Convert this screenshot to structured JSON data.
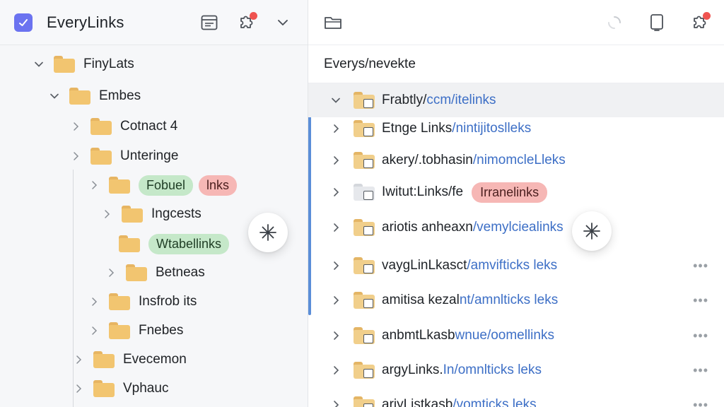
{
  "app": {
    "title": "EveryLinks"
  },
  "colors": {
    "accent": "#6b73f0",
    "link": "#3d6fc6",
    "folder": "#f2c570",
    "badge_red": "#ef5350",
    "pill_green": "#c5e8c9",
    "pill_red": "#f6b7b5"
  },
  "left_header": {
    "icons": [
      "browser-window-icon",
      "puzzle-icon",
      "chevron-down-icon"
    ]
  },
  "tree": [
    {
      "label": "FinyLats",
      "expanded": true,
      "level": 0
    },
    {
      "label": "Embes",
      "expanded": true,
      "level": 1
    },
    {
      "label": "Cotnact 4",
      "expanded": false,
      "level": 2
    },
    {
      "label": "Unteringe",
      "expanded": false,
      "level": 2
    },
    {
      "label": "Fobuel",
      "tag": "lnks",
      "level": 3
    },
    {
      "label": "Ingcests",
      "level": 4
    },
    {
      "label": "Wtabellinks",
      "level": 4
    },
    {
      "label": "Betneas",
      "level": 4
    },
    {
      "label": "Insfrob its",
      "level": 3
    },
    {
      "label": "Fnebes",
      "level": 3
    },
    {
      "label": "Evecemon",
      "level": 2
    },
    {
      "label": "Vphauc",
      "level": 2
    }
  ],
  "right_header": {
    "icons": [
      "folder-icon",
      "loading-spinner-icon",
      "tablet-icon",
      "puzzle-icon"
    ]
  },
  "path": "Everys/nevekte",
  "rows": [
    {
      "name": "Frabtly/",
      "link": "ccm/itelinks",
      "selected": true,
      "more": false
    },
    {
      "name": "Etnge Links",
      "link": "/nintijitoslleks",
      "more": false
    },
    {
      "name": "akery/.tobhasin",
      "link": "/nimomcleLleks",
      "more": false
    },
    {
      "name": "Iwitut:Links/fe",
      "tag": "Irranelinks",
      "more": false
    },
    {
      "name": "ariotis anheaxn",
      "link": "/vemylciealinks",
      "more": false
    },
    {
      "name": "vaygLinLkasct",
      "link": "/amvifticks leks",
      "more": true
    },
    {
      "name": "amitisa kezal",
      "link": "nt/amnlticks leks",
      "more": true
    },
    {
      "name": "anbmtLkasb",
      "link": "wnue/oomellinks",
      "more": true
    },
    {
      "name": "argyLinks.",
      "link": "In/omnlticks leks",
      "more": true
    },
    {
      "name": "ariyListkasb",
      "link": "/vomticks leks",
      "more": true
    }
  ]
}
